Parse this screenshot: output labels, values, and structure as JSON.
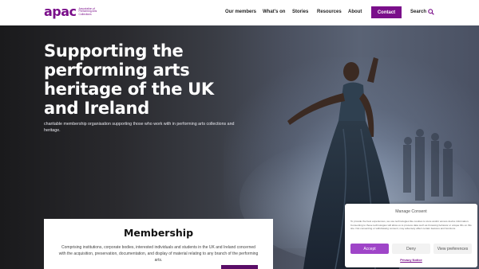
{
  "header": {
    "logo_word": "apac",
    "logo_sub": "Association of Performing Arts Collections",
    "nav": [
      "Our members",
      "What's on",
      "Stories",
      "Resources",
      "About"
    ],
    "contact_label": "Contact",
    "search_label": "Search"
  },
  "hero": {
    "title": "Supporting the performing arts heritage of the UK and Ireland",
    "subtitle": "charitable membership organisation supporting those who work with in performing arts collections and heritage."
  },
  "membership": {
    "title": "Membership",
    "text": "Comprising institutions, corporate bodies, interested individuals and students in the UK and Ireland concerned with the acquisition, preservation, documentation, and display of material relating to any branch of the performing arts."
  },
  "consent": {
    "title": "Manage Consent",
    "text": "To provide the best experiences, we use technologies like cookies to store and/or access device information. Consenting to these technologies will allow us to process data such as browsing behavior or unique IDs on this site. Not consenting or withdrawing consent, may adversely affect certain features and functions.",
    "accept_label": "Accept",
    "deny_label": "Deny",
    "prefs_label": "View preferences",
    "privacy_label": "Privacy Notice"
  },
  "colors": {
    "brand": "#7a0f8a",
    "accept": "#9f45c8"
  }
}
